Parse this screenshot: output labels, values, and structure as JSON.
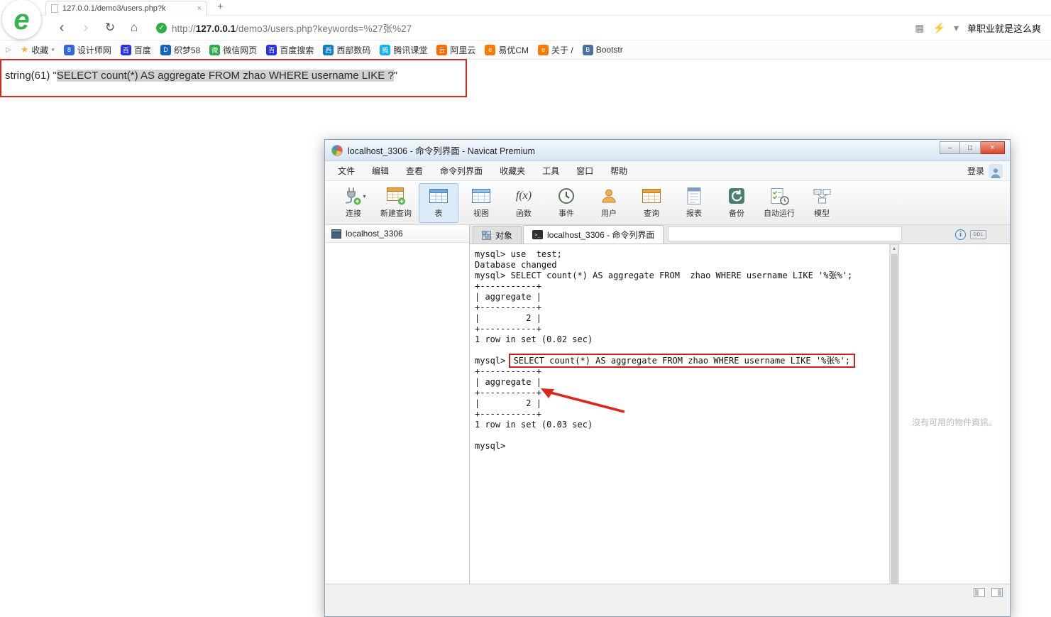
{
  "browser": {
    "tab": {
      "title": "127.0.0.1/demo3/users.php?k"
    },
    "icons": {
      "back": "‹",
      "forward": "›",
      "refresh": "↻",
      "home": "⌂",
      "shield_check": "✓",
      "apps_grid": "▦",
      "lightning": "⚡",
      "chevron_down": "▾",
      "bookmarks_toggle": "▷",
      "star": "★",
      "tab_close": "×",
      "new_tab": "+",
      "logo_letter": "e"
    },
    "address": {
      "scheme": "http://",
      "host": "127.0.0.1",
      "path": "/demo3/users.php?keywords=%27张%27"
    },
    "promo": "单职业就是这么爽",
    "bookmarks_label": "收藏",
    "bookmarks": [
      {
        "label": "设计师网",
        "char": "8",
        "color": "#2f68d8"
      },
      {
        "label": "百度",
        "char": "百",
        "color": "#2932e1"
      },
      {
        "label": "织梦58",
        "char": "D",
        "color": "#1565c0"
      },
      {
        "label": "微信网页",
        "char": "微",
        "color": "#2dab4f"
      },
      {
        "label": "百度搜索",
        "char": "百",
        "color": "#2932e1"
      },
      {
        "label": "西部数码",
        "char": "西",
        "color": "#0d7ec4"
      },
      {
        "label": "腾讯课堂",
        "char": "腾",
        "color": "#14b2f2"
      },
      {
        "label": "阿里云",
        "char": "云",
        "color": "#ff6a00"
      },
      {
        "label": "易优CM",
        "char": "e",
        "color": "#f57c00"
      },
      {
        "label": "关于 /",
        "char": "e",
        "color": "#f57c00"
      },
      {
        "label": "Bootstr",
        "char": "B",
        "color": "#4a6fa5"
      }
    ]
  },
  "page": {
    "prefix": "string(61) \"",
    "selected": "SELECT count(*) AS aggregate FROM zhao WHERE username LIKE ?",
    "suffix": "\""
  },
  "navicat": {
    "title": "localhost_3306 - 命令列界面 - Navicat Premium",
    "icons": {
      "minimize": "–",
      "maximize": "□",
      "close": "×",
      "caret": "▾",
      "scroll_up": "▲",
      "scroll_down": "▼",
      "info": "i"
    },
    "menus": [
      "文件",
      "编辑",
      "查看",
      "命令列界面",
      "收藏夹",
      "工具",
      "窗口",
      "帮助"
    ],
    "login_label": "登录",
    "toolbar": [
      {
        "label": "连接",
        "icon": "plug",
        "dropdown": true
      },
      {
        "label": "新建查询",
        "icon": "table-new"
      },
      {
        "label": "表",
        "icon": "table",
        "active": true
      },
      {
        "label": "视图",
        "icon": "view"
      },
      {
        "label": "函数",
        "icon": "fx"
      },
      {
        "label": "事件",
        "icon": "clock"
      },
      {
        "label": "用户",
        "icon": "user"
      },
      {
        "label": "查询",
        "icon": "query"
      },
      {
        "label": "报表",
        "icon": "report"
      },
      {
        "label": "备份",
        "icon": "backup"
      },
      {
        "label": "自动运行",
        "icon": "automation"
      },
      {
        "label": "模型",
        "icon": "model"
      }
    ],
    "sidebar": {
      "connection": "localhost_3306"
    },
    "tabs": [
      {
        "label": "对象",
        "icon": "grid"
      },
      {
        "label": "localhost_3306 - 命令列界面",
        "icon": "terminal",
        "active": true
      }
    ],
    "ddl_label": "DDL",
    "terminal": {
      "lines": [
        {
          "text": "mysql> use  test;"
        },
        {
          "text": "Database changed"
        },
        {
          "text": "mysql> SELECT count(*) AS aggregate FROM  zhao WHERE username LIKE '%张%';"
        },
        {
          "text": "+-----------+"
        },
        {
          "text": "| aggregate |"
        },
        {
          "text": "+-----------+"
        },
        {
          "text": "|         2 |"
        },
        {
          "text": "+-----------+"
        },
        {
          "text": "1 row in set (0.02 sec)"
        },
        {
          "text": ""
        },
        {
          "prefix": "mysql> ",
          "highlighted": "SELECT count(*) AS aggregate FROM zhao WHERE username LIKE '%张%';"
        },
        {
          "text": "+-----------+"
        },
        {
          "text": "| aggregate |"
        },
        {
          "text": "+-----------+"
        },
        {
          "text": "|         2 |"
        },
        {
          "text": "+-----------+"
        },
        {
          "text": "1 row in set (0.03 sec)"
        },
        {
          "text": ""
        },
        {
          "text": "mysql>"
        }
      ]
    },
    "right_panel": {
      "empty_text": "沒有可用的物件資訊。"
    }
  }
}
